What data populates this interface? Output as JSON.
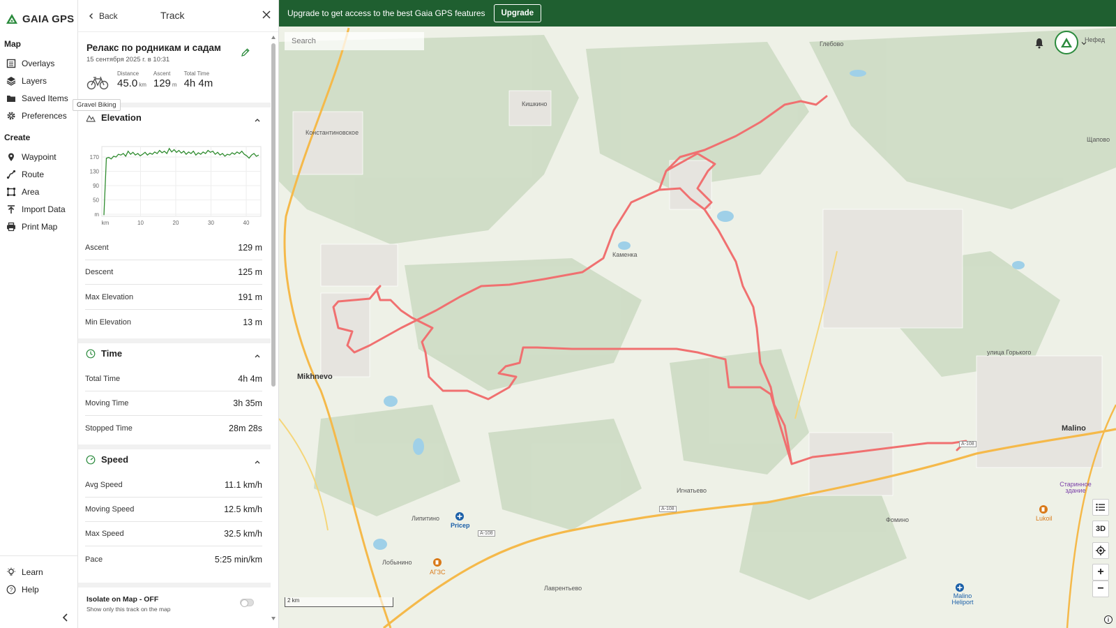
{
  "brand": {
    "name": "GAIA GPS"
  },
  "nav": {
    "map_heading": "Map",
    "map_items": [
      {
        "label": "Overlays",
        "icon": "overlays-icon"
      },
      {
        "label": "Layers",
        "icon": "layers-icon"
      },
      {
        "label": "Saved Items",
        "icon": "folder-icon"
      },
      {
        "label": "Preferences",
        "icon": "gear-icon"
      }
    ],
    "create_heading": "Create",
    "create_items": [
      {
        "label": "Waypoint",
        "icon": "waypoint-icon"
      },
      {
        "label": "Route",
        "icon": "route-icon"
      },
      {
        "label": "Area",
        "icon": "area-icon"
      },
      {
        "label": "Import Data",
        "icon": "import-icon"
      },
      {
        "label": "Print Map",
        "icon": "print-icon"
      }
    ],
    "bottom_items": [
      {
        "label": "Learn",
        "icon": "lightbulb-icon"
      },
      {
        "label": "Help",
        "icon": "help-icon"
      }
    ]
  },
  "panel": {
    "back_label": "Back",
    "title": "Track",
    "track_name": "Релакс по родникам и садам",
    "track_date": "15 сентября 2025 г. в 10:31",
    "tooltip": "Gravel Biking",
    "stats": {
      "distance_label": "Distance",
      "distance_value": "45.0",
      "distance_unit": "km",
      "ascent_label": "Ascent",
      "ascent_value": "129",
      "ascent_unit": "m",
      "time_label": "Total Time",
      "time_value": "4h 4m"
    },
    "elevation": {
      "heading": "Elevation",
      "chart_data": {
        "type": "line",
        "y_ticks": [
          "170",
          "130",
          "90",
          "50",
          "m"
        ],
        "x_ticks": [
          "km",
          "10",
          "20",
          "30",
          "40"
        ],
        "ylim": [
          10,
          190
        ],
        "xlim": [
          0,
          45
        ],
        "color": "#2e8b2e",
        "series": [
          {
            "values": [
              13,
              160,
              162,
              158,
              165,
              163,
              170,
              168,
              172,
              165,
              178,
              170,
              175,
              168,
              172,
              166,
              170,
              175,
              168,
              173,
              170,
              176,
              172,
              180,
              174,
              178,
              172,
              185,
              176,
              182,
              175,
              180,
              173,
              178,
              170,
              176,
              172,
              178,
              168,
              174,
              170,
              176,
              172,
              180,
              175,
              178,
              170,
              175,
              168,
              172,
              165,
              170,
              168,
              174,
              170,
              176,
              172,
              178,
              170,
              166,
              160,
              168,
              172,
              165,
              168
            ]
          }
        ]
      },
      "rows": [
        {
          "label": "Ascent",
          "value": "129 m"
        },
        {
          "label": "Descent",
          "value": "125 m"
        },
        {
          "label": "Max Elevation",
          "value": "191 m"
        },
        {
          "label": "Min Elevation",
          "value": "13 m"
        }
      ]
    },
    "time": {
      "heading": "Time",
      "rows": [
        {
          "label": "Total Time",
          "value": "4h 4m"
        },
        {
          "label": "Moving Time",
          "value": "3h 35m"
        },
        {
          "label": "Stopped Time",
          "value": "28m 28s"
        }
      ]
    },
    "speed": {
      "heading": "Speed",
      "rows": [
        {
          "label": "Avg Speed",
          "value": "11.1 km/h"
        },
        {
          "label": "Moving Speed",
          "value": "12.5 km/h"
        },
        {
          "label": "Max Speed",
          "value": "32.5 km/h"
        },
        {
          "label": "Pace",
          "value": "5:25 min/km"
        }
      ]
    },
    "isolate": {
      "title": "Isolate on Map - OFF",
      "subtitle": "Show only this track on the map",
      "enabled": false
    }
  },
  "map": {
    "banner_text": "Upgrade to get access to the best Gaia GPS features",
    "upgrade_label": "Upgrade",
    "search_placeholder": "Search",
    "scale_label": "2 km",
    "track_color": "#f07070",
    "places": [
      {
        "name": "Константиновское",
        "big": false
      },
      {
        "name": "Кишкино",
        "big": false
      },
      {
        "name": "Глебово",
        "big": false
      },
      {
        "name": "Каменка",
        "big": false
      },
      {
        "name": "Mikhnevo",
        "big": true
      },
      {
        "name": "Malino",
        "big": true
      },
      {
        "name": "Игнатьево",
        "big": false
      },
      {
        "name": "Липитино",
        "big": false
      },
      {
        "name": "Лобынино",
        "big": false
      },
      {
        "name": "Фомино",
        "big": false
      },
      {
        "name": "Лаврентьево",
        "big": false
      },
      {
        "name": "Pricep",
        "big": false
      },
      {
        "name": "АГЗС",
        "big": false
      },
      {
        "name": "Lukoil",
        "big": false
      },
      {
        "name": "Malino Heliport",
        "big": false
      },
      {
        "name": "Старинное здание",
        "big": false
      },
      {
        "name": "улица Горького",
        "big": false
      },
      {
        "name": "Щапово",
        "big": false
      },
      {
        "name": "Нефед",
        "big": false
      },
      {
        "name": "A-108",
        "big": false
      }
    ],
    "controls": {
      "three_d": "3D",
      "zoom_in": "+",
      "zoom_out": "−"
    }
  }
}
